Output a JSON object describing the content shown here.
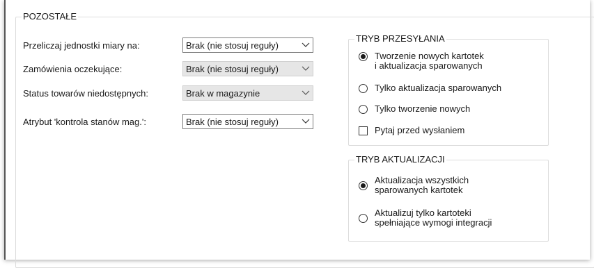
{
  "left_group": {
    "title": "POZOSTAŁE",
    "rows": [
      {
        "label": "Przeliczaj jednostki miary na:",
        "value": "Brak (nie stosuj reguły)",
        "enabled": true
      },
      {
        "label": "Zamówienia oczekujące:",
        "value": "Brak (nie stosuj reguły)",
        "enabled": false
      },
      {
        "label": "Status towarów niedostępnych:",
        "value": "Brak w magazynie",
        "enabled": false
      },
      {
        "label": "Atrybut 'kontrola stanów mag.':",
        "value": "Brak (nie stosuj reguły)",
        "enabled": true
      }
    ]
  },
  "send_mode": {
    "title": "TRYB PRZESYŁANIA",
    "options": [
      {
        "line1": "Tworzenie nowych kartotek",
        "line2": "i aktualizacja sparowanych",
        "selected": true
      },
      {
        "line1": "Tylko aktualizacja sparowanych",
        "line2": "",
        "selected": false
      },
      {
        "line1": "Tylko tworzenie nowych",
        "line2": "",
        "selected": false
      }
    ],
    "confirm_checkbox": {
      "label": "Pytaj przed wysłaniem",
      "checked": false
    }
  },
  "update_mode": {
    "title": "TRYB AKTUALIZACJI",
    "options": [
      {
        "line1": "Aktualizacja wszystkich",
        "line2": "sparowanych kartotek",
        "selected": true
      },
      {
        "line1": "Aktualizuj tylko kartoteki",
        "line2": "spełniające wymogi integracji",
        "selected": false
      }
    ]
  },
  "icons": {
    "dropdown": "chevron-down-icon"
  }
}
